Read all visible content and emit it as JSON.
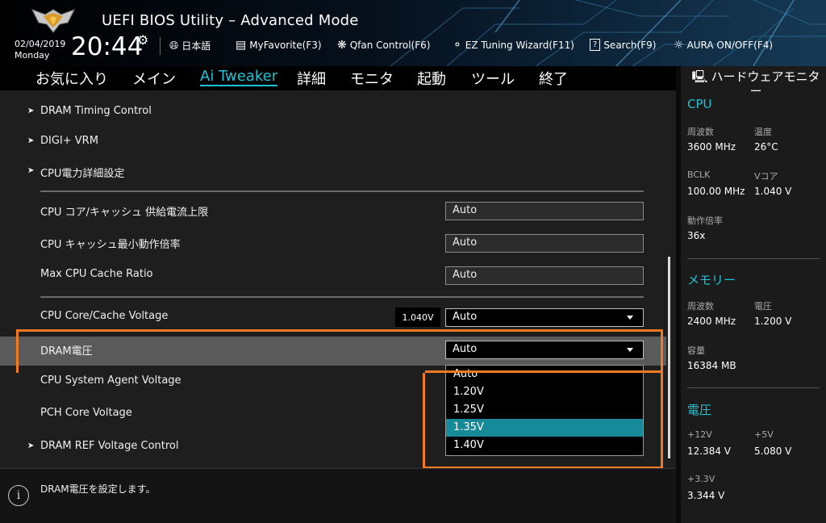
{
  "header": {
    "title": "UEFI BIOS Utility – Advanced Mode",
    "date": "02/04/2019",
    "day": "Monday",
    "time": "20:44",
    "tools": [
      {
        "label": "日本語",
        "icon": "globe-icon"
      },
      {
        "label": "MyFavorite(F3)",
        "icon": "favorite-list-icon"
      },
      {
        "label": "Qfan Control(F6)",
        "icon": "fan-icon"
      },
      {
        "label": "EZ Tuning Wizard(F11)",
        "icon": "bulb-icon"
      },
      {
        "label": "Search(F9)",
        "icon": "search-help-icon"
      },
      {
        "label": "AURA ON/OFF(F4)",
        "icon": "aura-light-icon"
      }
    ]
  },
  "menu": {
    "items": [
      "お気に入り",
      "メイン",
      "Ai Tweaker",
      "詳細",
      "モニタ",
      "起動",
      "ツール",
      "終了"
    ],
    "active": "Ai Tweaker"
  },
  "settings": {
    "submenus": [
      "DRAM Timing Control",
      "DIGI+ VRM",
      "CPU電力詳細設定"
    ],
    "cpu_current_limit": {
      "label": "CPU コア/キャッシュ 供給電流上限",
      "value": "Auto"
    },
    "cpu_cache_min_ratio": {
      "label": "CPU キャッシュ最小動作倍率",
      "value": "Auto"
    },
    "max_cpu_cache_ratio": {
      "label": "Max CPU Cache Ratio",
      "value": "Auto"
    },
    "cpu_core_cache_voltage": {
      "label": "CPU Core/Cache Voltage",
      "reading": "1.040V",
      "value": "Auto"
    },
    "dram_voltage": {
      "label": "DRAM電圧",
      "value": "Auto"
    },
    "system_agent_voltage": {
      "label": "CPU System Agent Voltage"
    },
    "pch_core_voltage": {
      "label": "PCH Core Voltage"
    },
    "dram_ref_voltage": {
      "label": "DRAM REF Voltage Control"
    }
  },
  "dropdown": {
    "options": [
      "Auto",
      "1.20V",
      "1.25V",
      "1.35V",
      "1.40V"
    ],
    "highlighted": "1.35V"
  },
  "help": {
    "text": "DRAM電圧を設定します。"
  },
  "monitor": {
    "title": "ハードウェアモニター",
    "cpu": {
      "heading": "CPU",
      "freq_label": "周波数",
      "freq": "3600 MHz",
      "temp_label": "温度",
      "temp": "26°C",
      "bclk_label": "BCLK",
      "bclk": "100.00 MHz",
      "vcore_label": "Vコア",
      "vcore": "1.040 V",
      "ratio_label": "動作倍率",
      "ratio": "36x"
    },
    "memory": {
      "heading": "メモリー",
      "freq_label": "周波数",
      "freq": "2400 MHz",
      "volt_label": "電圧",
      "volt": "1.200 V",
      "cap_label": "容量",
      "cap": "16384 MB"
    },
    "voltage": {
      "heading": "電圧",
      "p12_label": "+12V",
      "p12": "12.384 V",
      "p5_label": "+5V",
      "p5": "5.080 V",
      "p33_label": "+3.3V",
      "p33": "3.344 V"
    }
  },
  "colors": {
    "accent": "#1dc3d4",
    "highlight": "#168a99",
    "annotation": "#f07a22"
  }
}
